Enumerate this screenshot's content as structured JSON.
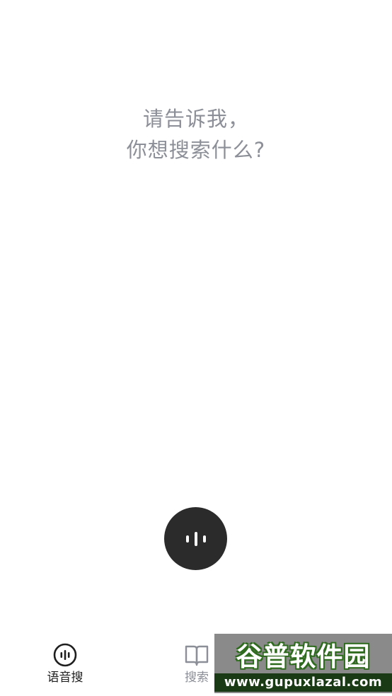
{
  "prompt": {
    "line1": "请告诉我，",
    "line2": "你想搜索什么?"
  },
  "mic_button": {
    "icon": "voice-wave-icon",
    "color": "#2b2b2b"
  },
  "tabbar": {
    "tabs": [
      {
        "label": "语音搜",
        "icon": "voice-circle-icon",
        "active": true
      },
      {
        "label": "搜索",
        "icon": "book-icon",
        "active": false
      },
      {
        "label": "",
        "icon": "",
        "active": false
      }
    ]
  },
  "watermark": {
    "brand": "谷普软件园",
    "url": "www.gupuxlazal.com"
  },
  "colors": {
    "prompt_text": "#8c8f97",
    "active_tab": "#1f1f1f",
    "inactive_tab": "#8c8f97",
    "mic_bg": "#2b2b2b"
  }
}
